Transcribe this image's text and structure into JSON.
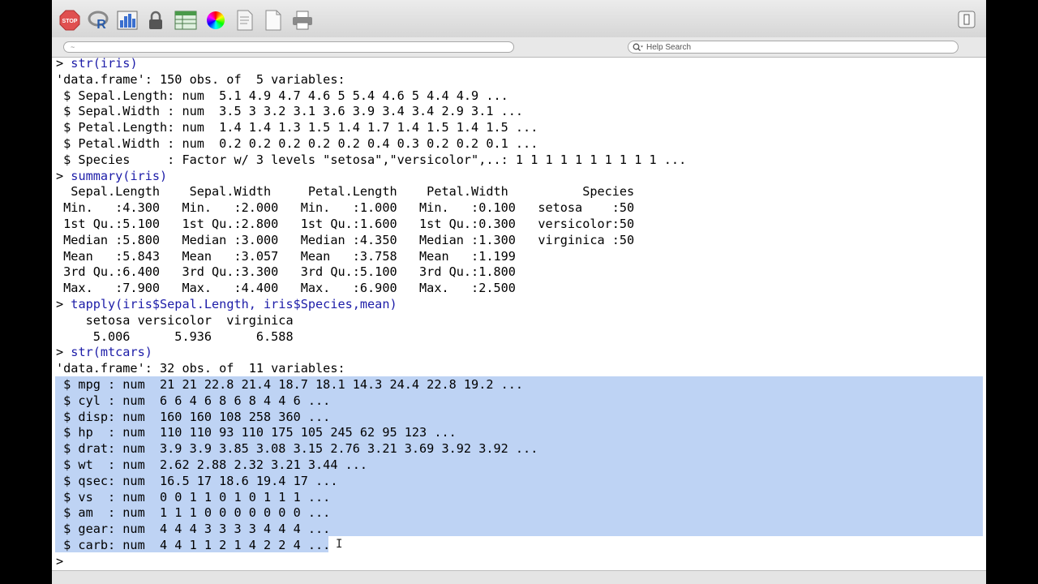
{
  "toolbar": {
    "buttons": [
      {
        "name": "stop-icon",
        "label": "STOP"
      },
      {
        "name": "r-logo-icon"
      },
      {
        "name": "bar-chart-icon"
      },
      {
        "name": "lock-icon"
      },
      {
        "name": "table-icon"
      },
      {
        "name": "color-wheel-icon"
      },
      {
        "name": "document-edit-icon"
      },
      {
        "name": "new-document-icon"
      },
      {
        "name": "printer-icon"
      }
    ],
    "right_button": "sidebar-toggle-icon"
  },
  "pathbar": {
    "path": "~",
    "help_search_placeholder": "Help Search"
  },
  "console": {
    "lines": [
      {
        "prompt": "> ",
        "text": "str(iris)",
        "type": "cmd"
      },
      {
        "text": "'data.frame': 150 obs. of  5 variables:",
        "type": "out"
      },
      {
        "text": " $ Sepal.Length: num  5.1 4.9 4.7 4.6 5 5.4 4.6 5 4.4 4.9 ...",
        "type": "out"
      },
      {
        "text": " $ Sepal.Width : num  3.5 3 3.2 3.1 3.6 3.9 3.4 3.4 2.9 3.1 ...",
        "type": "out"
      },
      {
        "text": " $ Petal.Length: num  1.4 1.4 1.3 1.5 1.4 1.7 1.4 1.5 1.4 1.5 ...",
        "type": "out"
      },
      {
        "text": " $ Petal.Width : num  0.2 0.2 0.2 0.2 0.2 0.4 0.3 0.2 0.2 0.1 ...",
        "type": "out"
      },
      {
        "text": " $ Species     : Factor w/ 3 levels \"setosa\",\"versicolor\",..: 1 1 1 1 1 1 1 1 1 1 ...",
        "type": "out"
      },
      {
        "prompt": "> ",
        "text": "summary(iris)",
        "type": "cmd"
      },
      {
        "text": "  Sepal.Length    Sepal.Width     Petal.Length    Petal.Width          Species  ",
        "type": "out"
      },
      {
        "text": " Min.   :4.300   Min.   :2.000   Min.   :1.000   Min.   :0.100   setosa    :50  ",
        "type": "out"
      },
      {
        "text": " 1st Qu.:5.100   1st Qu.:2.800   1st Qu.:1.600   1st Qu.:0.300   versicolor:50  ",
        "type": "out"
      },
      {
        "text": " Median :5.800   Median :3.000   Median :4.350   Median :1.300   virginica :50  ",
        "type": "out"
      },
      {
        "text": " Mean   :5.843   Mean   :3.057   Mean   :3.758   Mean   :1.199                  ",
        "type": "out"
      },
      {
        "text": " 3rd Qu.:6.400   3rd Qu.:3.300   3rd Qu.:5.100   3rd Qu.:1.800                  ",
        "type": "out"
      },
      {
        "text": " Max.   :7.900   Max.   :4.400   Max.   :6.900   Max.   :2.500                  ",
        "type": "out"
      },
      {
        "prompt": "> ",
        "text": "tapply(iris$Sepal.Length, iris$Species,mean)",
        "type": "cmd"
      },
      {
        "text": "    setosa versicolor  virginica ",
        "type": "out"
      },
      {
        "text": "     5.006      5.936      6.588 ",
        "type": "out"
      },
      {
        "prompt": "> ",
        "text": "str(mtcars)",
        "type": "cmd"
      },
      {
        "text": "'data.frame': 32 obs. of  11 variables:",
        "type": "out"
      },
      {
        "text": " $ mpg : num  21 21 22.8 21.4 18.7 18.1 14.3 24.4 22.8 19.2 ...",
        "type": "out"
      },
      {
        "text": " $ cyl : num  6 6 4 6 8 6 8 4 4 6 ...",
        "type": "out"
      },
      {
        "text": " $ disp: num  160 160 108 258 360 ...",
        "type": "out"
      },
      {
        "text": " $ hp  : num  110 110 93 110 175 105 245 62 95 123 ...",
        "type": "out"
      },
      {
        "text": " $ drat: num  3.9 3.9 3.85 3.08 3.15 2.76 3.21 3.69 3.92 3.92 ...",
        "type": "out"
      },
      {
        "text": " $ wt  : num  2.62 2.88 2.32 3.21 3.44 ...",
        "type": "out"
      },
      {
        "text": " $ qsec: num  16.5 17 18.6 19.4 17 ...",
        "type": "out"
      },
      {
        "text": " $ vs  : num  0 0 1 1 0 1 0 1 1 1 ...",
        "type": "out"
      },
      {
        "text": " $ am  : num  1 1 1 0 0 0 0 0 0 0 ...",
        "type": "out"
      },
      {
        "text": " $ gear: num  4 4 4 3 3 3 3 4 4 4 ...",
        "type": "out"
      },
      {
        "text": " $ carb: num  4 4 1 1 2 1 4 2 2 4 ...",
        "type": "out"
      },
      {
        "prompt": "> ",
        "text": "",
        "type": "cmd"
      }
    ]
  },
  "colors": {
    "command": "#1c1ca8",
    "selection": "#bed3f4",
    "background": "#ffffff"
  }
}
